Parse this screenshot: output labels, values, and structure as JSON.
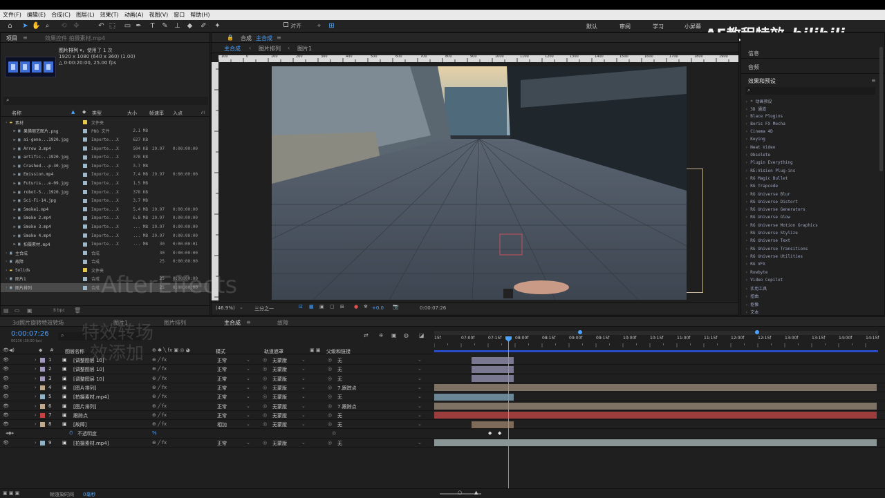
{
  "menu": [
    "文件(F)",
    "编辑(E)",
    "合成(C)",
    "图层(L)",
    "效果(T)",
    "动画(A)",
    "视图(V)",
    "窗口",
    "帮助(H)"
  ],
  "toolbar": {
    "align_label": "对齐",
    "workspaces": [
      "默认",
      "审阅",
      "学习",
      "小屏幕"
    ]
  },
  "watermark": {
    "brand": "AE教程特效",
    "overlay_ae": "AfterEffects",
    "overlay_cn1": "特效转场",
    "overlay_cn2": "效添加"
  },
  "project": {
    "tab": "项目",
    "tab2": "效果控件 拍摄素材.mp4",
    "selected_name": "图片排列",
    "used": "▾，使用了 1 次",
    "dims": "1920 x 1080 (640 x 360) (1.00)",
    "duration": "△ 0:00:20:00, 25.00 fps",
    "search_icon": "⌕",
    "headers": {
      "name": "名称",
      "type": "类型",
      "size": "大小",
      "fps": "帧速率",
      "in": "入点"
    },
    "items": [
      {
        "name": "素材",
        "type": "文件夹",
        "size": "",
        "fps": "",
        "in": "",
        "indent": 0,
        "color": "#e6c84b"
      },
      {
        "name": "果佛丽艺图片.png",
        "type": "PNG 文件",
        "size": "2.1 MB",
        "fps": "",
        "in": "",
        "indent": 1,
        "color": "#9fb8c9"
      },
      {
        "name": "ai-gene...1920.jpg",
        "type": "Importe...X",
        "size": "627 KB",
        "fps": "",
        "in": "",
        "indent": 1,
        "color": "#9fb8c9"
      },
      {
        "name": "Arrow 3.mp4",
        "type": "Importe...X",
        "size": "504 KB",
        "fps": "29.97",
        "in": "0:00:00:00",
        "indent": 1,
        "color": "#9fb8c9"
      },
      {
        "name": "artific...1920.jpg",
        "type": "Importe...X",
        "size": "378 KB",
        "fps": "",
        "in": "",
        "indent": 1,
        "color": "#9fb8c9"
      },
      {
        "name": "Crashed...p-30.jpg",
        "type": "Importe...X",
        "size": "3.7 MB",
        "fps": "",
        "in": "",
        "indent": 1,
        "color": "#9fb8c9"
      },
      {
        "name": "Emission.mp4",
        "type": "Importe...X",
        "size": "7.4 MB",
        "fps": "29.97",
        "in": "0:00:00:00",
        "indent": 1,
        "color": "#9fb8c9"
      },
      {
        "name": "Futuris...e-09.jpg",
        "type": "Importe...X",
        "size": "1.5 MB",
        "fps": "",
        "in": "",
        "indent": 1,
        "color": "#9fb8c9"
      },
      {
        "name": "robot-5...1920.jpg",
        "type": "Importe...X",
        "size": "378 KB",
        "fps": "",
        "in": "",
        "indent": 1,
        "color": "#9fb8c9"
      },
      {
        "name": "Sci-Fi-14.jpg",
        "type": "Importe...X",
        "size": "3.7 MB",
        "fps": "",
        "in": "",
        "indent": 1,
        "color": "#9fb8c9"
      },
      {
        "name": "Smoke1.mp4",
        "type": "Importe...X",
        "size": "5.4 MB",
        "fps": "29.97",
        "in": "0:00:00:00",
        "indent": 1,
        "color": "#9fb8c9"
      },
      {
        "name": "Smoke 2.mp4",
        "type": "Importe...X",
        "size": "6.8 MB",
        "fps": "29.97",
        "in": "0:00:00:00",
        "indent": 1,
        "color": "#9fb8c9"
      },
      {
        "name": "Smoke 3.mp4",
        "type": "Importe...X",
        "size": "... MB",
        "fps": "29.97",
        "in": "0:00:00:00",
        "indent": 1,
        "color": "#9fb8c9"
      },
      {
        "name": "Smoke 4.mp4",
        "type": "Importe...X",
        "size": "... MB",
        "fps": "29.97",
        "in": "0:00:00:00",
        "indent": 1,
        "color": "#9fb8c9"
      },
      {
        "name": "拍摄素材.mp4",
        "type": "Importe...X",
        "size": "... MB",
        "fps": "30",
        "in": "0:00:00:01",
        "indent": 1,
        "color": "#9fb8c9"
      },
      {
        "name": "主合成",
        "type": "合成",
        "size": "",
        "fps": "30",
        "in": "0:00:00:00",
        "indent": 0,
        "color": "#9fb8c9"
      },
      {
        "name": "故障",
        "type": "合成",
        "size": "",
        "fps": "25",
        "in": "0:00:00:00",
        "indent": 0,
        "color": "#9fb8c9"
      },
      {
        "name": "Solids",
        "type": "文件夹",
        "size": "",
        "fps": "",
        "in": "",
        "indent": 0,
        "color": "#e6c84b"
      },
      {
        "name": "图片1",
        "type": "合成",
        "size": "",
        "fps": "25",
        "in": "0:00:00:00",
        "indent": 0,
        "color": "#9fb8c9"
      },
      {
        "name": "图片排列",
        "type": "合成",
        "size": "",
        "fps": "25",
        "in": "0:00:00:00",
        "indent": 0,
        "color": "#9fb8c9"
      }
    ],
    "bpc": "8 bpc"
  },
  "comp": {
    "tab": "合成",
    "tab_name": "主合成",
    "menu": "≡",
    "subtabs": [
      "主合成",
      "图片排列",
      "图片1"
    ],
    "ruler": [
      "100",
      "0",
      "100",
      "200",
      "300",
      "400",
      "500",
      "600",
      "700",
      "800",
      "900",
      "1000",
      "1100",
      "1200",
      "1300",
      "1400",
      "1500",
      "1600",
      "1700",
      "1800",
      "1900",
      "2000"
    ],
    "zoom": "(46.9%)",
    "resolution": "三分之一",
    "exposure": "+0.0",
    "timecode": "0:00:07:26"
  },
  "right": {
    "info": "信息",
    "audio": "音频",
    "effects_title": "效果和预设",
    "effects": [
      "* 动画预设",
      "3D 通道",
      "Blace Plugins",
      "Boris FX Mocha",
      "Cinema 4D",
      "Keying",
      "Neat Video",
      "Obsolete",
      "Plugin Everything",
      "RE:Vision Plug-ins",
      "RG Magic Bullet",
      "RG Trapcode",
      "RG Universe Blur",
      "RG Universe Distort",
      "RG Universe Generators",
      "RG Universe Glow",
      "RG Universe Motion Graphics",
      "RG Universe Stylize",
      "RG Universe Text",
      "RG Universe Transitions",
      "RG Universe Utilities",
      "RG VFX",
      "Rowbyte",
      "Video Copilot",
      "实用工具",
      "扭曲",
      "抠像",
      "文本"
    ]
  },
  "timeline": {
    "tabs": [
      "3d照片旋转特效转场",
      "图片1",
      "图片排列",
      "主合成",
      "故障"
    ],
    "active_tab": "主合成",
    "timecode": "0:00:07:26",
    "sub_timecode": "00236 (30.00 fps)",
    "headers": {
      "layer": "图层名称",
      "mode": "模式",
      "track": "轨道遮罩",
      "parent": "父级和链接"
    },
    "ruler": [
      "15f",
      "07:00f",
      "07:15f",
      "08:00f",
      "08:15f",
      "09:00f",
      "09:15f",
      "10:00f",
      "10:15f",
      "11:00f",
      "11:15f",
      "12:00f",
      "12:15f",
      "13:00f",
      "13:15f",
      "14:00f",
      "14:15f"
    ],
    "layers": [
      {
        "num": "1",
        "name": "[调整图层 10]",
        "mode": "正常",
        "track": "无蒙版",
        "parent": "无",
        "color": "#a49ac0",
        "bar_color": "#7a7890",
        "bar": [
          0.085,
          0.18
        ]
      },
      {
        "num": "2",
        "name": "[调整图层 10]",
        "mode": "正常",
        "track": "无蒙版",
        "parent": "无",
        "color": "#a49ac0",
        "bar_color": "#7a7890",
        "bar": [
          0.085,
          0.18
        ]
      },
      {
        "num": "3",
        "name": "[调整图层 10]",
        "mode": "正常",
        "track": "无蒙版",
        "parent": "无",
        "color": "#a49ac0",
        "bar_color": "#7a7890",
        "bar": [
          0.085,
          0.18
        ]
      },
      {
        "num": "4",
        "name": "[图片排列]",
        "mode": "正常",
        "track": "无蒙版",
        "parent": "7.跟踪点",
        "color": "#bfa98a",
        "bar_color": "#7d7263",
        "bar": [
          0,
          1
        ]
      },
      {
        "num": "5",
        "name": "[拍摄素材.mp4]",
        "mode": "正常",
        "track": "无蒙版",
        "parent": "无",
        "color": "#8fb3c5",
        "bar_color": "#6b8796",
        "bar": [
          0,
          0.18
        ]
      },
      {
        "num": "6",
        "name": "[图片排列]",
        "mode": "正常",
        "track": "无蒙版",
        "parent": "7.跟踪点",
        "color": "#bfa98a",
        "bar_color": "#7d7263",
        "bar": [
          0,
          1
        ]
      },
      {
        "num": "7",
        "name": "跟踪点",
        "mode": "正常",
        "track": "无蒙版",
        "parent": "无",
        "color": "#c94040",
        "bar_color": "#9c3d3d",
        "bar": [
          0,
          1
        ]
      },
      {
        "num": "8",
        "name": "[故障]",
        "mode": "相加",
        "track": "无蒙版",
        "parent": "无",
        "color": "#bfa98a",
        "bar_color": "#7d6a58",
        "bar": [
          0.085,
          0.18
        ]
      },
      {
        "num": "",
        "name": "不透明度",
        "mode": "",
        "track": "",
        "parent": "",
        "color": "",
        "bar_color": "",
        "bar": [
          0,
          0
        ]
      },
      {
        "num": "9",
        "name": "[拍摄素材.mp4]",
        "mode": "正常",
        "track": "无蒙版",
        "parent": "无",
        "color": "#8fb3c5",
        "bar_color": "#8a9596",
        "bar": [
          0,
          1
        ]
      }
    ],
    "footer": {
      "render_label": "帧渲染时间",
      "render_value": "0毫秒"
    }
  }
}
